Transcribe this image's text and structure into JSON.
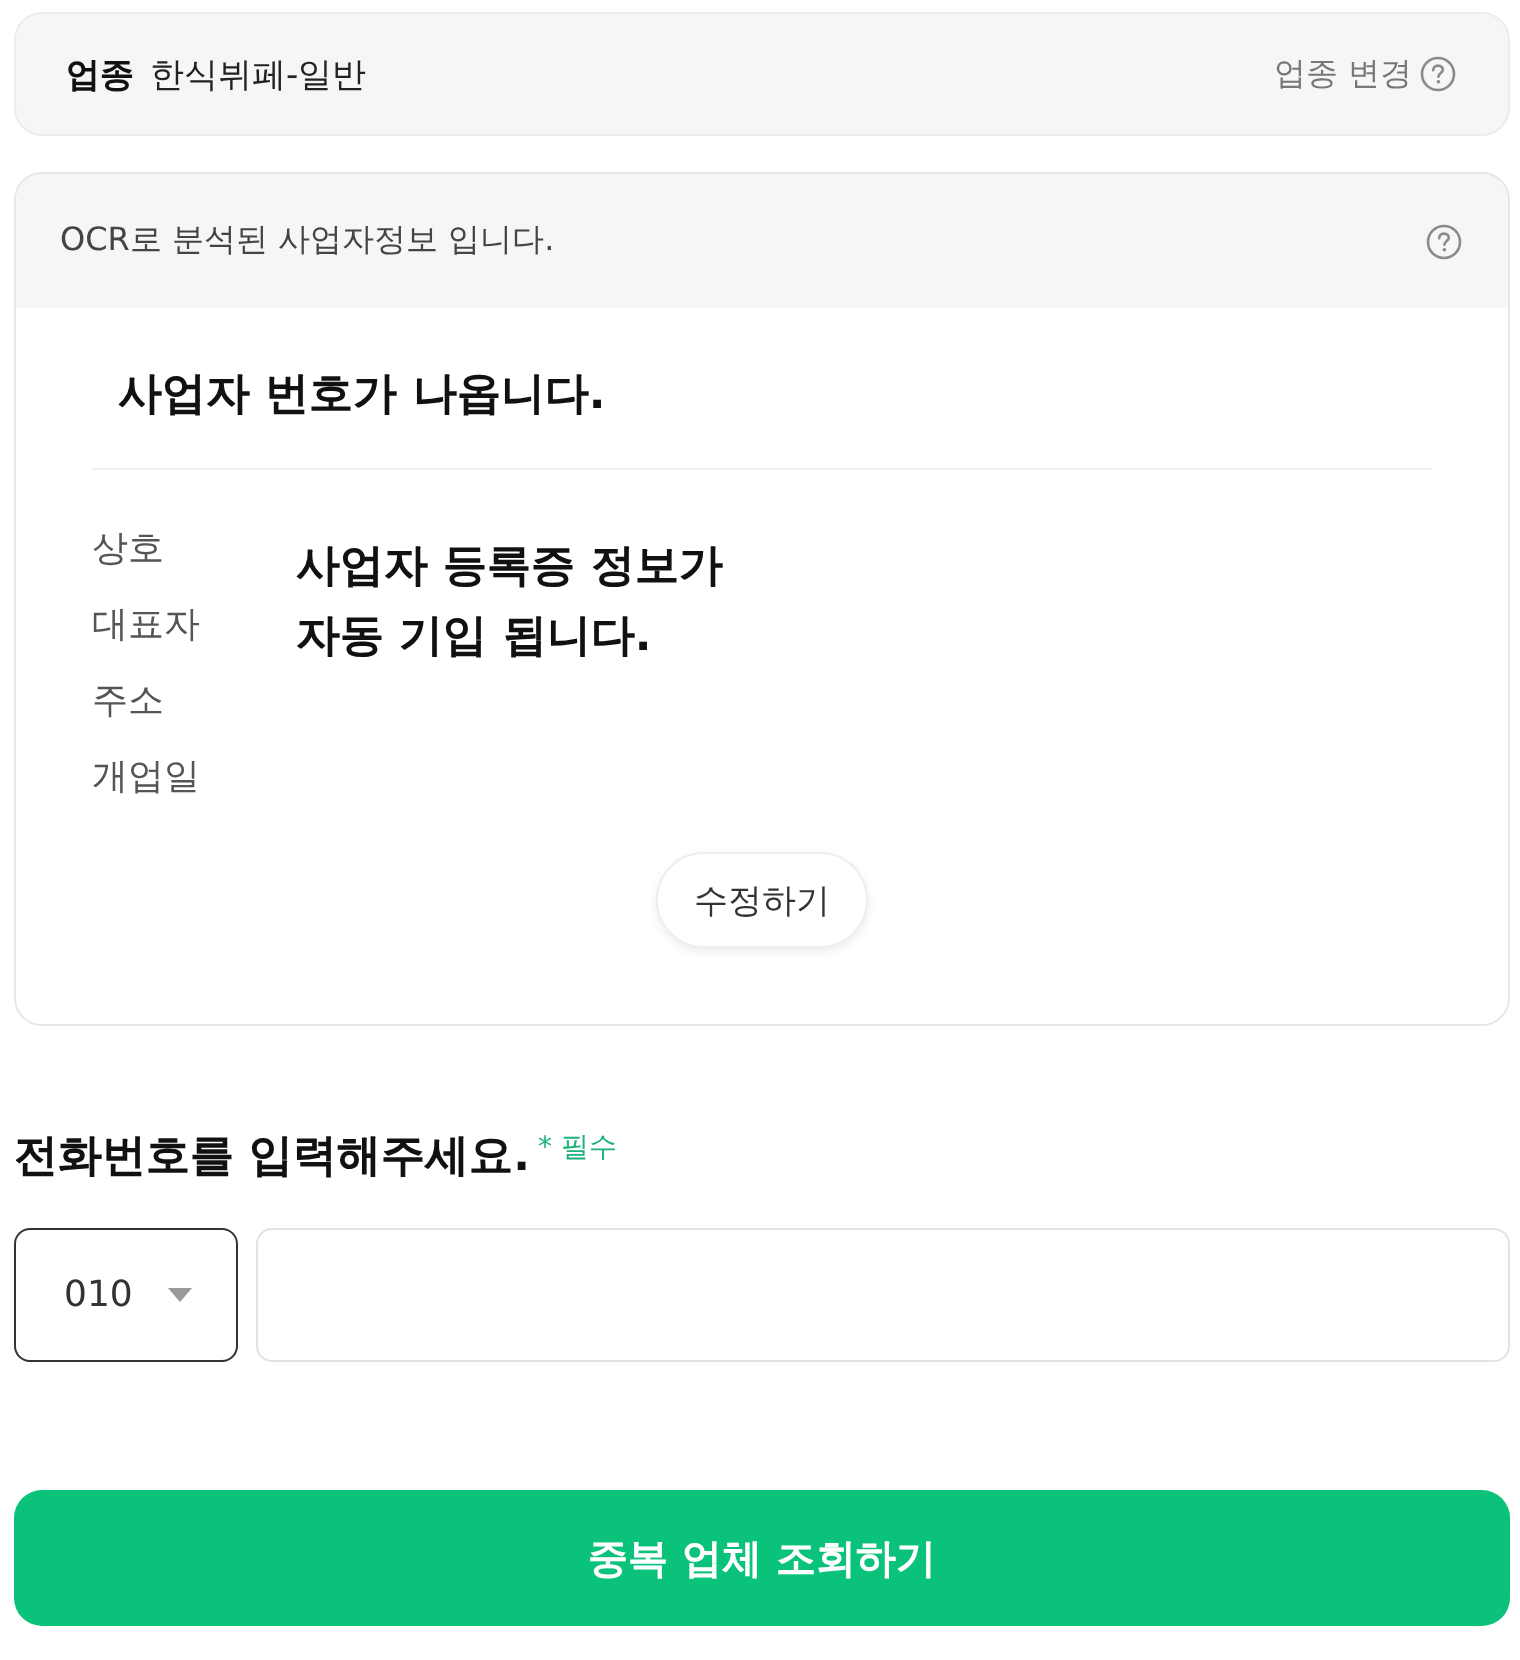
{
  "industry": {
    "label": "업종",
    "value": "한식뷔페-일반",
    "change_link": "업종 변경"
  },
  "business_info": {
    "header": "OCR로 분석된 사업자정보 입니다.",
    "business_number": "사업자 번호가 나옵니다.",
    "fields": [
      "상호",
      "대표자",
      "주소",
      "개업일"
    ],
    "notice": "사업자 등록증 정보가\n자동 기입 됩니다.",
    "edit_button": "수정하기"
  },
  "phone": {
    "title": "전화번호를 입력해주세요.",
    "required": "* 필수",
    "prefix": "010"
  },
  "submit_button": "중복 업체 조회하기"
}
